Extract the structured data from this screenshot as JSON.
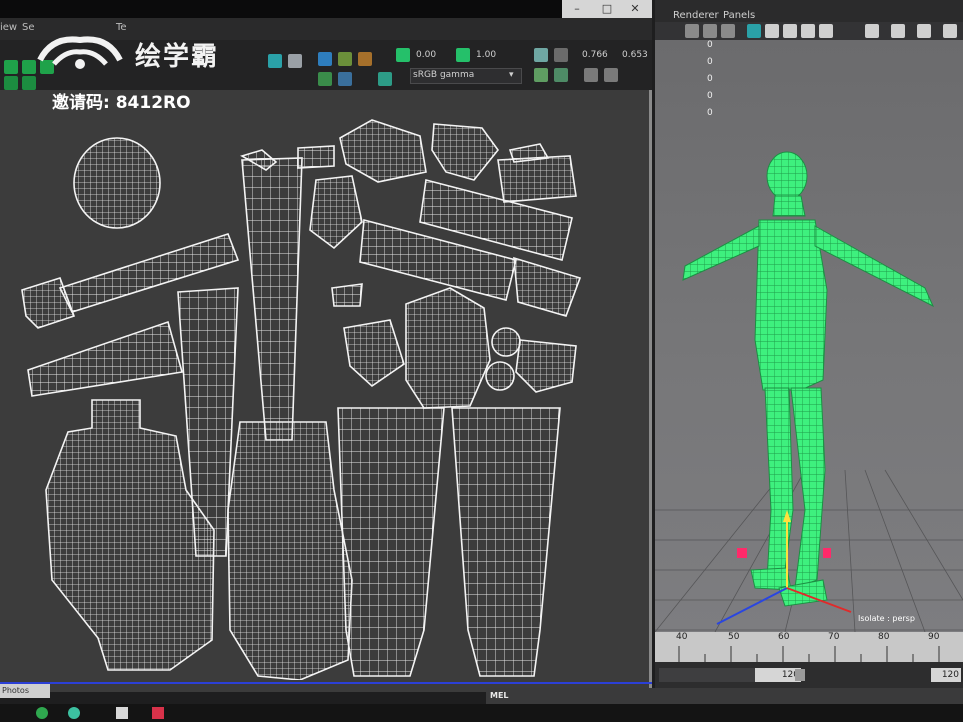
{
  "uv_editor": {
    "menu": [
      "iew",
      "Se",
      "Te"
    ],
    "toolbar": {
      "exposure_value": "0.00",
      "gamma_value": "1.00",
      "color_space": "sRGB gamma",
      "value_a": "0.766",
      "value_b": "0.653"
    }
  },
  "watermark": {
    "brand": "绘学霸",
    "invite_code": "邀请码: 8412RO"
  },
  "viewport": {
    "menu": [
      "Renderer",
      "Panels"
    ],
    "readout": [
      "0",
      "0",
      "0",
      "0",
      "0"
    ],
    "hud_label": "Isolate : persp"
  },
  "timeline": {
    "ticks": [
      "40",
      "50",
      "60",
      "70",
      "80",
      "90"
    ],
    "range_end": "120",
    "range_end_field": "120"
  },
  "command_line": {
    "label": "MEL"
  },
  "taskbar": {
    "photoshop_tab": "Photos"
  },
  "colors": {
    "uv_wire": "#f4f4f4",
    "mesh_green": "#2ee66e",
    "canvas_bg": "#3c3c3c",
    "timeline_bg": "#c8c8c8"
  }
}
